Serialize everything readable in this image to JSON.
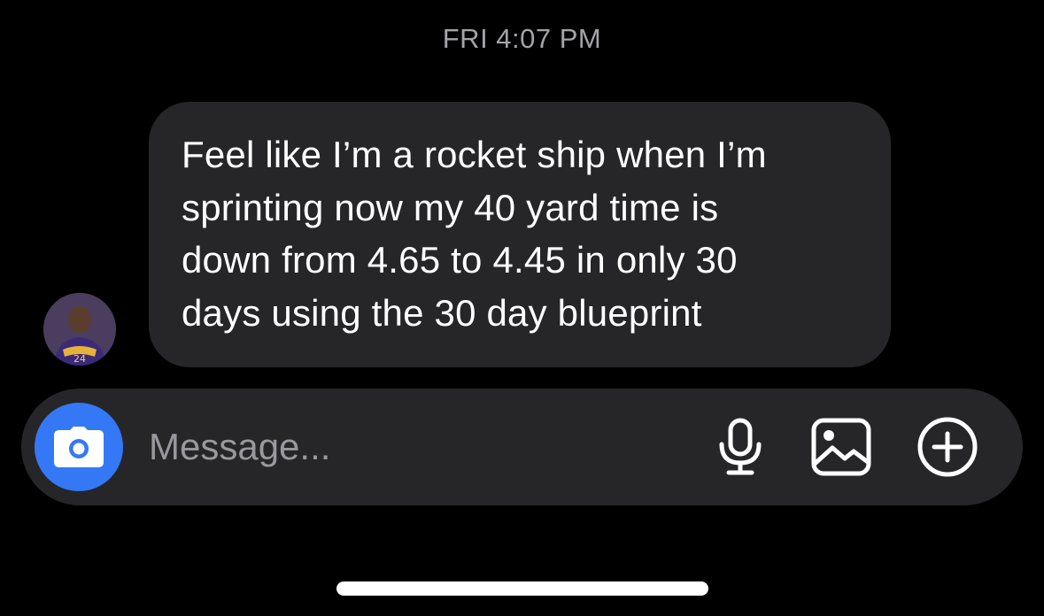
{
  "thread": {
    "timestamp": "FRI 4:07 PM",
    "message": {
      "sender_avatar_icon": "avatar-photo",
      "text": "Feel like I’m a rocket ship when I’m\nsprinting now my 40 yard time is\ndown from 4.65 to 4.45 in only 30\ndays using the 30 day blueprint"
    }
  },
  "composer": {
    "placeholder": "Message...",
    "value": "",
    "icons": {
      "camera": "camera-icon",
      "mic": "microphone-icon",
      "gallery": "image-gallery-icon",
      "more": "plus-circle-icon"
    }
  },
  "colors": {
    "background": "#000000",
    "bubble": "#262628",
    "accent": "#3478f6",
    "timestamp": "#a3a3a8"
  }
}
